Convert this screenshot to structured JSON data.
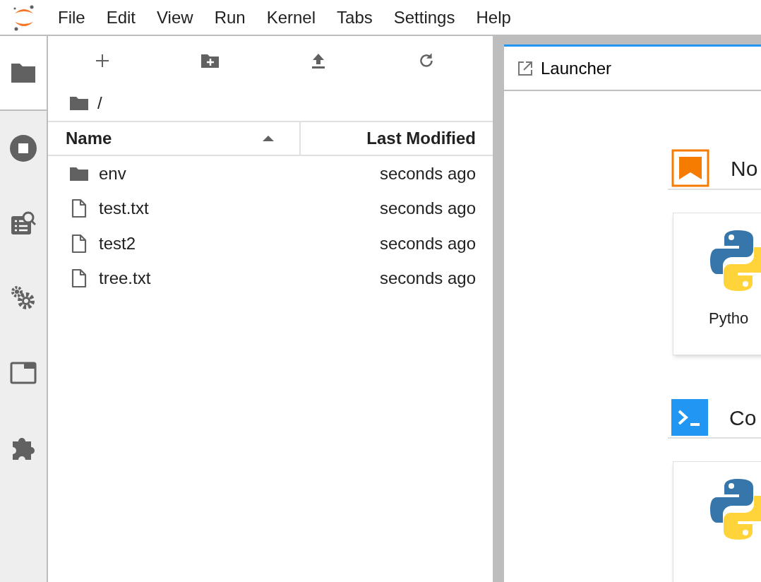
{
  "menu_bar": {
    "items": [
      "File",
      "Edit",
      "View",
      "Run",
      "Kernel",
      "Tabs",
      "Settings",
      "Help"
    ]
  },
  "side_tabs": [
    {
      "kind": "folder",
      "selected": true
    },
    {
      "kind": "running",
      "selected": false
    },
    {
      "kind": "commands",
      "selected": false
    },
    {
      "kind": "gears",
      "selected": false
    },
    {
      "kind": "tabs",
      "selected": false
    },
    {
      "kind": "extensions",
      "selected": false
    }
  ],
  "breadcrumb": "/",
  "file_table": {
    "columns": [
      {
        "label": "Name",
        "sorted": true
      },
      {
        "label": "Last Modified",
        "sorted": false
      }
    ],
    "rows": [
      {
        "kind": "folder",
        "name": "env",
        "modified": "seconds ago"
      },
      {
        "kind": "file",
        "name": "test.txt",
        "modified": "seconds ago"
      },
      {
        "kind": "file",
        "name": "test2",
        "modified": "seconds ago"
      },
      {
        "kind": "file",
        "name": "tree.txt",
        "modified": "seconds ago"
      }
    ]
  },
  "main_tab": {
    "title": "Launcher"
  },
  "launcher": {
    "sections": [
      {
        "kind": "notebook",
        "title": "No",
        "cards": [
          {
            "kind": "python",
            "label": "Pytho"
          }
        ]
      },
      {
        "kind": "console",
        "title": "Co",
        "cards": [
          {
            "kind": "python"
          }
        ]
      }
    ]
  }
}
